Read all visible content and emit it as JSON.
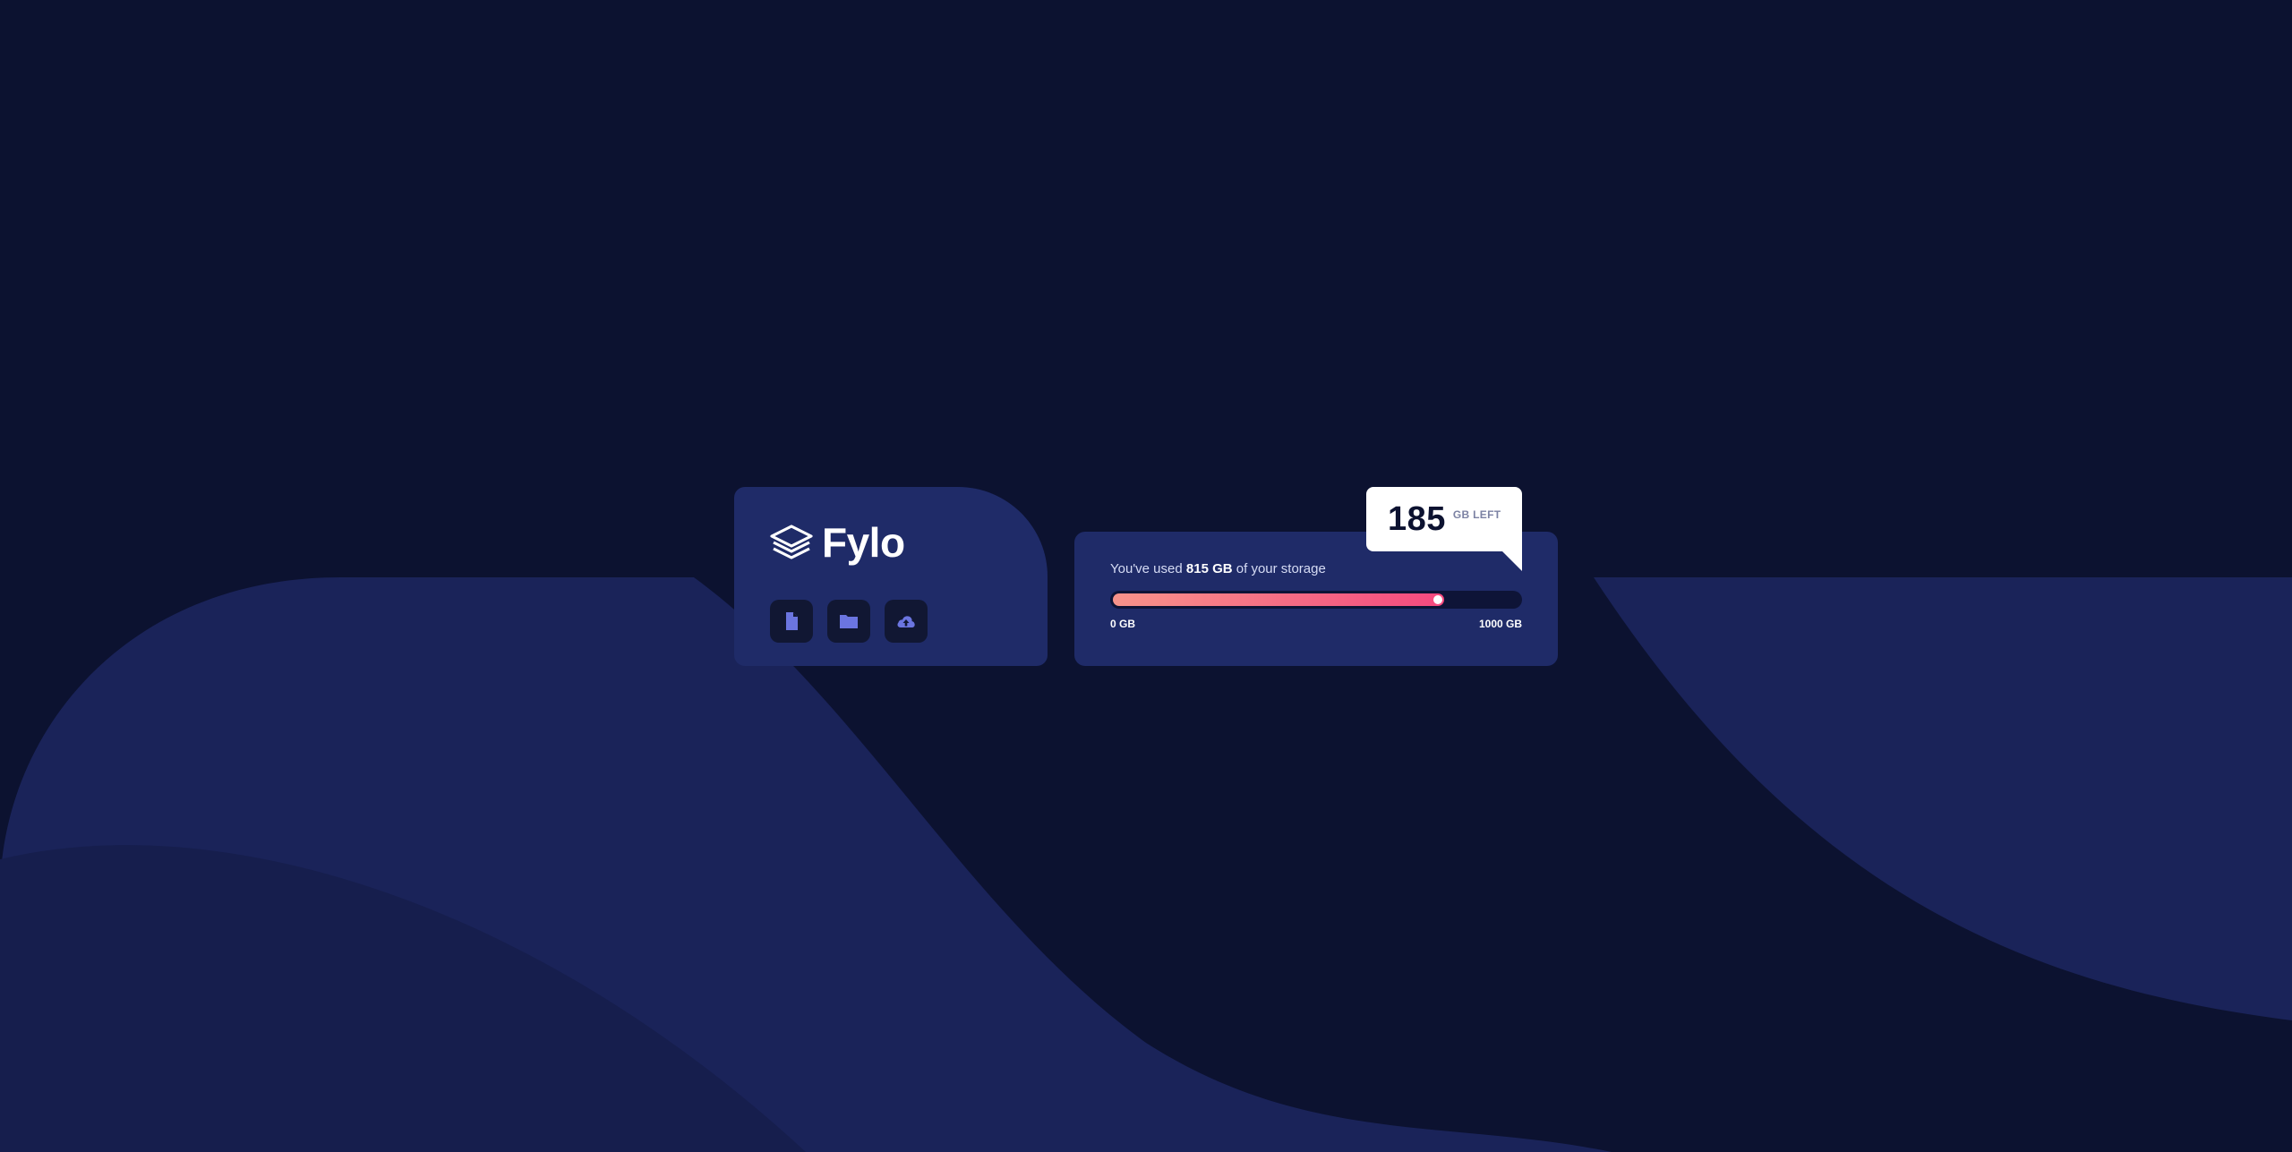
{
  "app": {
    "name": "Fylo",
    "colors": {
      "background": "#0c1230",
      "card": "#1f2b68",
      "button_bg": "#111733",
      "icon": "#6b75e0",
      "bar_start": "#f7938a",
      "bar_end": "#f6497f",
      "callout": "#ffffff"
    }
  },
  "brand_card": {
    "logo_icon": "layers-icon",
    "logo_text": "Fylo",
    "actions": [
      {
        "icon": "document-icon"
      },
      {
        "icon": "folder-icon"
      },
      {
        "icon": "cloud-upload-icon"
      }
    ]
  },
  "storage": {
    "used_prefix": "You've used ",
    "used_value": "815 GB",
    "used_suffix": " of your storage",
    "progress_fraction": 0.815,
    "scale_min": "0 GB",
    "scale_max": "1000 GB",
    "remaining_value": "185",
    "remaining_unit": "GB LEFT"
  }
}
